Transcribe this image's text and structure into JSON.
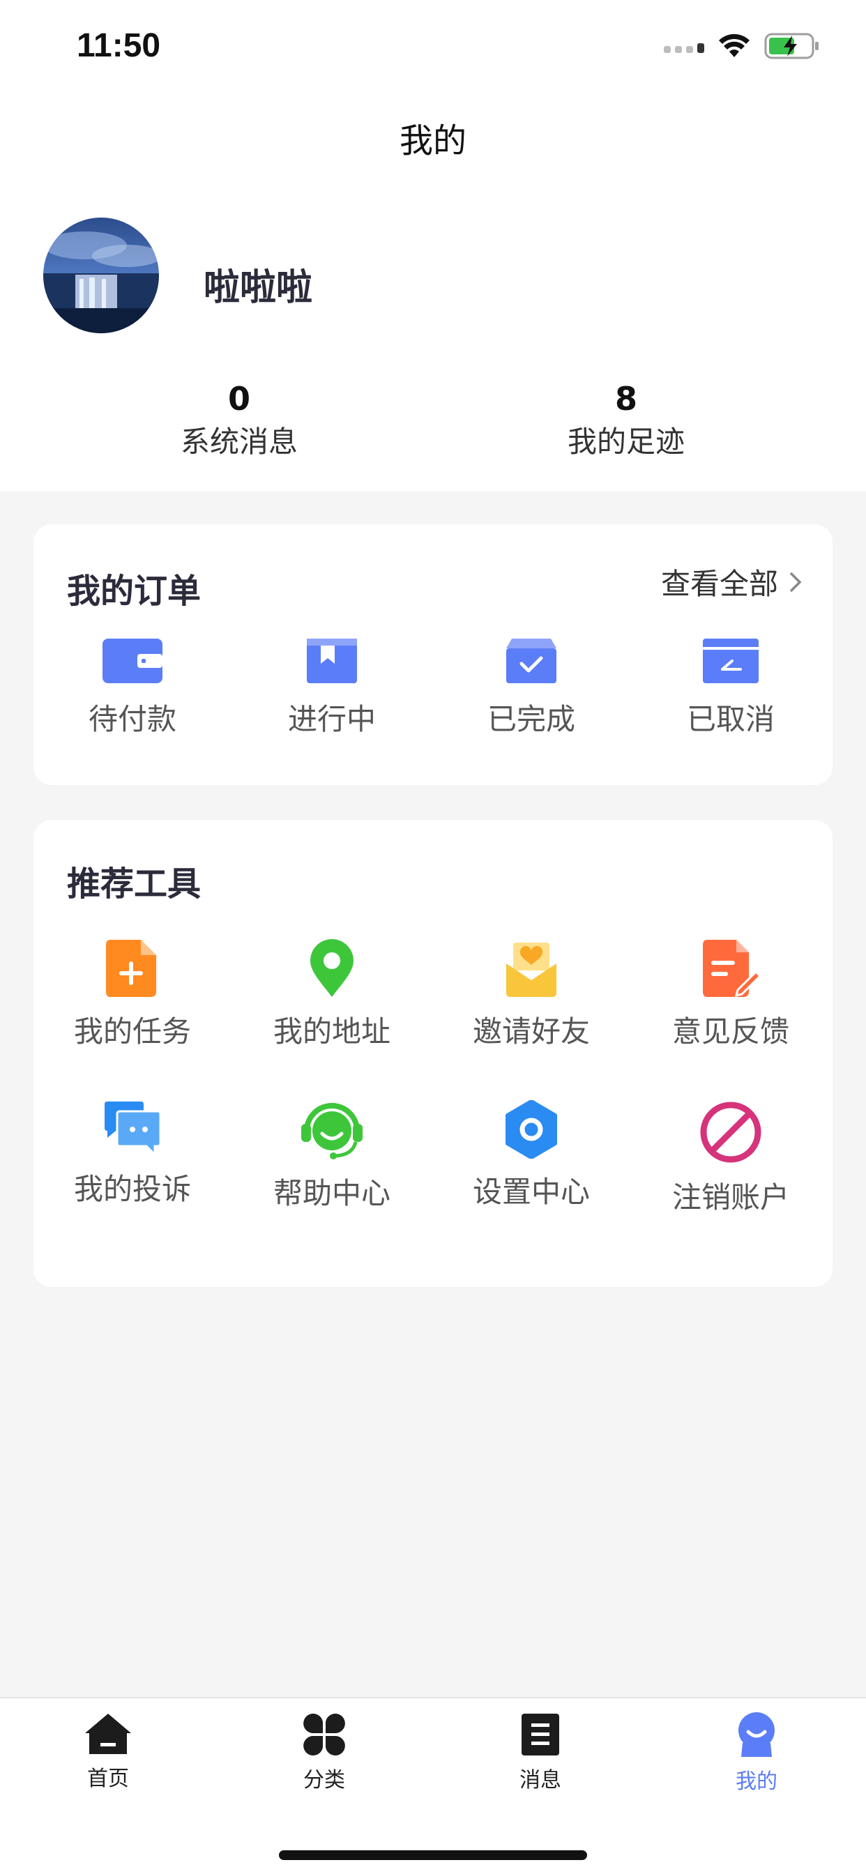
{
  "status_bar": {
    "time": "11:50"
  },
  "header": {
    "title": "我的"
  },
  "profile": {
    "username": "啦啦啦",
    "stats": [
      {
        "value": "0",
        "label": "系统消息"
      },
      {
        "value": "8",
        "label": "我的足迹"
      }
    ]
  },
  "orders": {
    "title": "我的订单",
    "view_all": "查看全部",
    "items": [
      {
        "label": "待付款",
        "icon": "wallet-icon"
      },
      {
        "label": "进行中",
        "icon": "bookmark-box-icon"
      },
      {
        "label": "已完成",
        "icon": "box-check-icon"
      },
      {
        "label": "已取消",
        "icon": "box-cancel-icon"
      }
    ]
  },
  "tools": {
    "title": "推荐工具",
    "items": [
      {
        "label": "我的任务",
        "icon": "task-add-icon",
        "color": "#ff8a1f"
      },
      {
        "label": "我的地址",
        "icon": "location-pin-icon",
        "color": "#3ec63b"
      },
      {
        "label": "邀请好友",
        "icon": "invite-envelope-icon",
        "color": "#f9c53b"
      },
      {
        "label": "意见反馈",
        "icon": "feedback-edit-icon",
        "color": "#ff6a3d"
      },
      {
        "label": "我的投诉",
        "icon": "chat-bubbles-icon",
        "color": "#2a8bf2"
      },
      {
        "label": "帮助中心",
        "icon": "headset-icon",
        "color": "#3ec63b"
      },
      {
        "label": "设置中心",
        "icon": "settings-gear-icon",
        "color": "#2a8bf2"
      },
      {
        "label": "注销账户",
        "icon": "forbidden-icon",
        "color": "#d6337b"
      }
    ]
  },
  "tab_bar": {
    "tabs": [
      {
        "label": "首页",
        "icon": "home-icon"
      },
      {
        "label": "分类",
        "icon": "category-grid-icon"
      },
      {
        "label": "消息",
        "icon": "message-doc-icon"
      },
      {
        "label": "我的",
        "icon": "profile-icon",
        "active": true
      }
    ]
  },
  "colors": {
    "accent": "#5b7df7",
    "order_icon": "#5b7df7"
  }
}
